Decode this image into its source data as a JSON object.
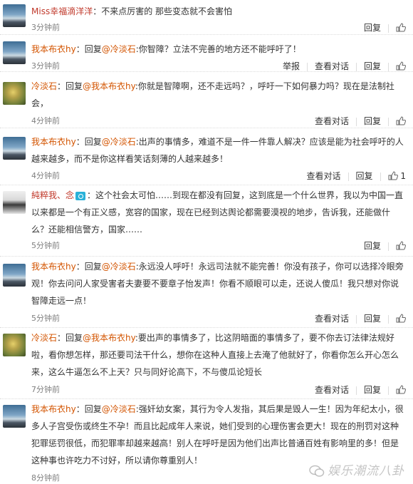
{
  "comments": [
    {
      "user": "Miss幸福滴洋洋",
      "reply_prefix": "",
      "reply_to": "",
      "body": "：不来点厉害的 那些变态就不会害怕",
      "time": "3分钟前",
      "actions": {
        "view": "",
        "report": "",
        "reply": "回复",
        "likes": ""
      }
    },
    {
      "user": "我本布衣hy",
      "reply_prefix": "：回复",
      "reply_to": "@冷淡石",
      "body": ":你智障？立法不完善的地方还不能呼吁了！",
      "time": "3分钟前",
      "actions": {
        "report": "举报",
        "view": "查看对话",
        "reply": "回复",
        "likes": ""
      }
    },
    {
      "user": "冷淡石",
      "reply_prefix": "：回复",
      "reply_to": "@我本布衣hy",
      "body": ":你就是智障啊，还不走远吗？，呼吁一下如何暴力吗？现在是法制社会，",
      "time": "4分钟前",
      "actions": {
        "report": "",
        "view": "查看对话",
        "reply": "回复",
        "likes": ""
      }
    },
    {
      "user": "我本布衣hy",
      "reply_prefix": "：回复",
      "reply_to": "@冷淡石",
      "body": ":出声的事情多，难道不是一件一件靠人解决？应该是能为社会呼吁的人越来越多，而不是你这样看笑话刻薄的人越来越多！",
      "time": "4分钟前",
      "actions": {
        "report": "",
        "view": "查看对话",
        "reply": "回复",
        "likes": "1"
      }
    },
    {
      "user": "純粹我、念",
      "reply_prefix": "",
      "reply_to": "",
      "body": "：这个社会太可怕……到现在都没有回复，这到底是一个什么世界，我以为中国一直以来都是一个有正义感，宽容的国家，现在已经到达舆论都需要漠视的地步，告诉我，还能做什么？还能相信警方，国家……",
      "time": "5分钟前",
      "actions": {
        "report": "",
        "view": "",
        "reply": "回复",
        "likes": ""
      }
    },
    {
      "user": "我本布衣hy",
      "reply_prefix": "：回复",
      "reply_to": "@冷淡石",
      "body": ":永远没人呼吁！永远司法就不能完善！你没有孩子，你可以选择冷眼旁观！你去问问人家受害者夫妻要不要章子怡发声！你看不顺眼可以走，还说人傻瓜！我只想对你说智障走远一点！",
      "time": "5分钟前",
      "actions": {
        "report": "",
        "view": "查看对话",
        "reply": "回复",
        "likes": ""
      }
    },
    {
      "user": "冷淡石",
      "reply_prefix": "：回复",
      "reply_to": "@我本布衣hy",
      "body": ":要出声的事情多了，比这阴暗面的事情多了，要不你去订法律法规好啦，看你想怎样，那还要司法干什么，想你在这种人直接上去淹了他就好了，你看你怎么开心怎么来，这么牛逼怎么不上天？只与同好论高下，不与傻瓜论短长",
      "time": "7分钟前",
      "actions": {
        "report": "",
        "view": "查看对话",
        "reply": "回复",
        "likes": ""
      }
    },
    {
      "user": "我本布衣hy",
      "reply_prefix": "：回复",
      "reply_to": "@冷淡石",
      "body": ":强奸幼女案，其行为令人发指，其后果是毁人一生！因为年纪太小，很多人子宫受伤或终生不孕！而且比起成年人来说，她们受到的心理伤害会更大！现在的刑罚对这种犯罪惩罚很低，而犯罪率却越来越高！别人在呼吁是因为他们出声比普通百姓有影响里的多！但是这种事也许吃力不讨好，所以请你尊重别人！",
      "time": "8分钟前",
      "actions": {
        "report": "",
        "view": "",
        "reply": "",
        "likes": ""
      }
    }
  ],
  "watermark": "娱乐潮流八卦",
  "colors": {
    "username": "#d35400",
    "time": "#808080",
    "divider": "#dcdcdc"
  }
}
